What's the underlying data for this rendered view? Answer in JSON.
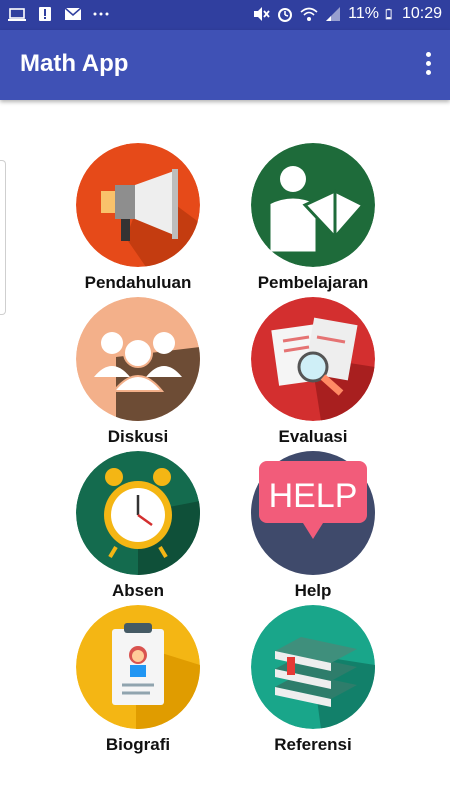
{
  "status_bar": {
    "battery": "11%",
    "time": "10:29",
    "icons_left": [
      "laptop-icon",
      "alert-icon",
      "mail-icon",
      "more-icon"
    ],
    "icons_right": [
      "mute-icon",
      "alarm-icon",
      "wifi-icon",
      "signal-icon",
      "battery-icon"
    ]
  },
  "app_bar": {
    "title": "Math App",
    "menu_icon": "overflow-menu-icon"
  },
  "menu": [
    {
      "label": "Pendahuluan",
      "icon": "megaphone-icon",
      "color": "#e64a19"
    },
    {
      "label": "Pembelajaran",
      "icon": "reading-person-icon",
      "color": "#1e6b3a"
    },
    {
      "label": "Diskusi",
      "icon": "group-icon",
      "color": "#f3b08a"
    },
    {
      "label": "Evaluasi",
      "icon": "document-search-icon",
      "color": "#d32f2f"
    },
    {
      "label": "Absen",
      "icon": "alarm-clock-icon",
      "color": "#146b4e"
    },
    {
      "label": "Help",
      "icon": "help-sign-icon",
      "color": "#3f4a6b"
    },
    {
      "label": "Biografi",
      "icon": "clipboard-profile-icon",
      "color": "#f4b614"
    },
    {
      "label": "Referensi",
      "icon": "book-stack-icon",
      "color": "#19a68a"
    }
  ],
  "colors": {
    "status_bar": "#303f9f",
    "app_bar": "#3f51b5"
  }
}
